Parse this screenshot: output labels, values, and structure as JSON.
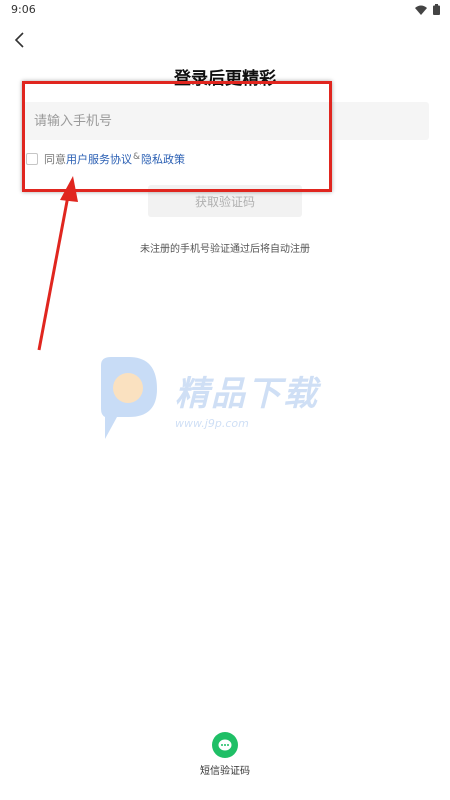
{
  "status_bar": {
    "time": "9:06"
  },
  "header": {
    "title": "登录后更精彩"
  },
  "phone": {
    "placeholder": "请输入手机号"
  },
  "agreement": {
    "prefix": "同意",
    "user_agreement": "用户服务协议",
    "separator": "&",
    "privacy_policy": "隐私政策"
  },
  "get_code_label": "获取验证码",
  "hint": "未注册的手机号验证通过后将自动注册",
  "watermark": {
    "title": "精品下载",
    "url": "www.j9p.com"
  },
  "sms_login": {
    "label": "短信验证码",
    "icon": "chat-bubble-icon",
    "color": "#1fbf66"
  },
  "annotation": {
    "color": "#e0261f"
  }
}
